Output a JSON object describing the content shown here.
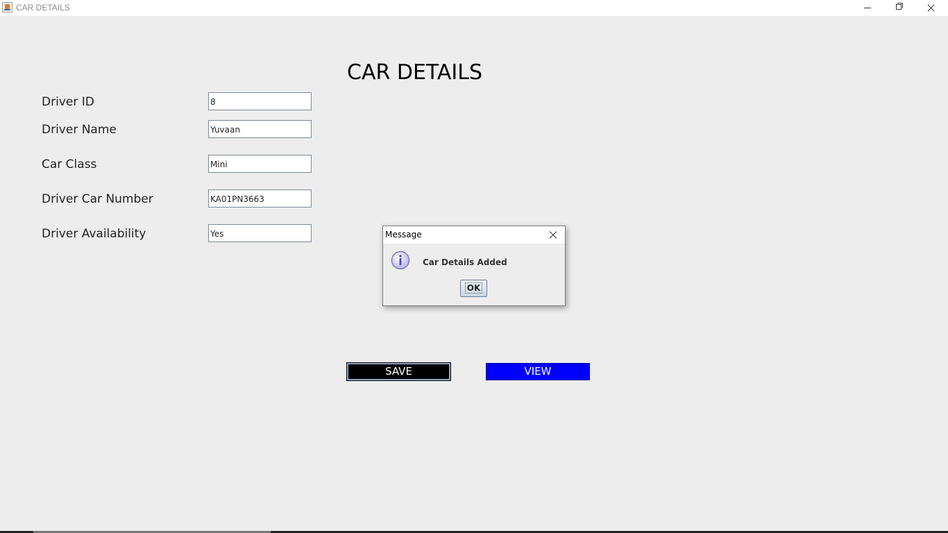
{
  "window": {
    "title": "CAR DETAILS"
  },
  "form": {
    "heading": "CAR DETAILS",
    "fields": [
      {
        "label": "Driver ID",
        "value": "8"
      },
      {
        "label": "Driver Name",
        "value": "Yuvaan"
      },
      {
        "label": "Car Class",
        "value": "Mini"
      },
      {
        "label": "Driver Car Number",
        "value": "KA01PN3663"
      },
      {
        "label": "Driver Availability",
        "value": "Yes"
      }
    ],
    "save_label": "SAVE",
    "view_label": "VIEW"
  },
  "dialog": {
    "title": "Message",
    "message": "Car Details Added",
    "ok_label": "OK",
    "icon": "info-icon"
  },
  "colors": {
    "background": "#ededed",
    "save_button": "#000000",
    "view_button": "#0000ff"
  }
}
